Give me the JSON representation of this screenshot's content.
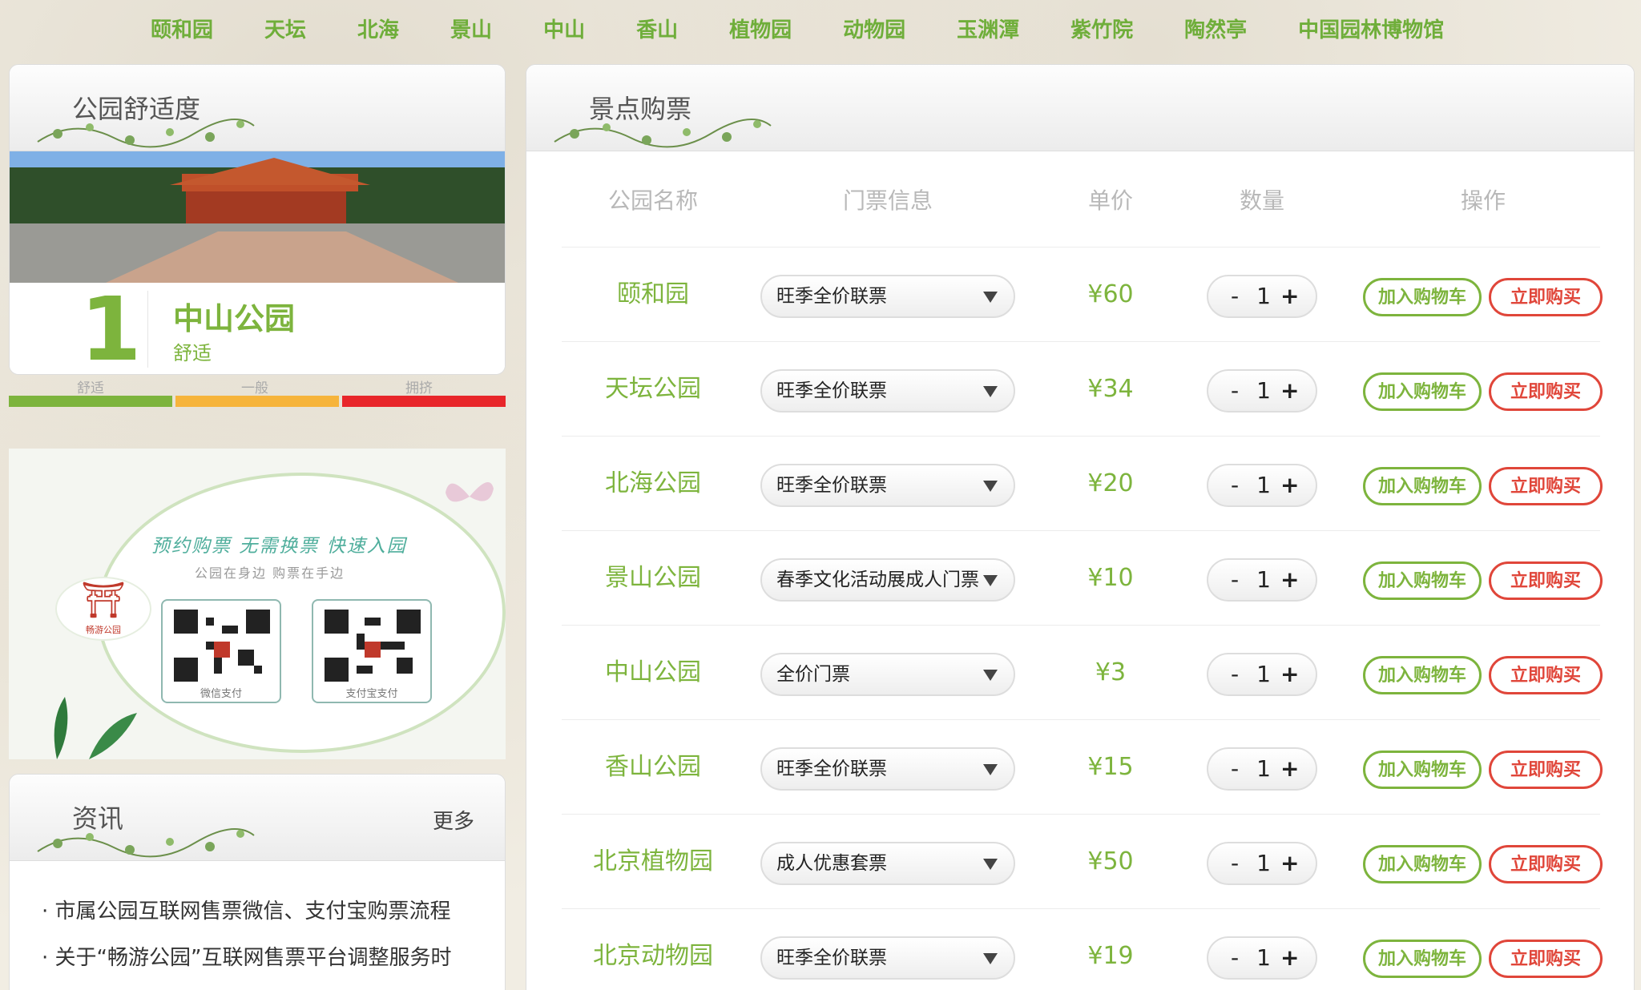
{
  "nav": [
    "颐和园",
    "天坛",
    "北海",
    "景山",
    "中山",
    "香山",
    "植物园",
    "动物园",
    "玉渊潭",
    "紫竹院",
    "陶然亭",
    "中国园林博物馆"
  ],
  "comfort": {
    "title": "公园舒适度",
    "level_number": "1",
    "park_name": "中山公园",
    "status": "舒适",
    "levels": [
      "舒适",
      "一般",
      "拥挤"
    ],
    "level_colors": [
      "#7db43d",
      "#f6b43b",
      "#e8262a"
    ]
  },
  "promo": {
    "slogan": "预约购票  无需换票  快速入园",
    "sub": "公园在身边  购票在手边",
    "logo_label": "畅游公园",
    "qr_wechat": "微信支付",
    "qr_alipay": "支付宝支付"
  },
  "news": {
    "title": "资讯",
    "more": "更多",
    "items": [
      "· 市属公园互联网售票微信、支付宝购票流程",
      "· 关于“畅游公园”互联网售票平台调整服务时"
    ]
  },
  "tickets": {
    "title": "景点购票",
    "columns": [
      "公园名称",
      "门票信息",
      "单价",
      "数量",
      "操作"
    ],
    "cart_label": "加入购物车",
    "buy_label": "立即购买",
    "minus": "-",
    "plus": "+",
    "rows": [
      {
        "park": "颐和园",
        "ticket": "旺季全价联票",
        "price": "¥60",
        "qty": "1"
      },
      {
        "park": "天坛公园",
        "ticket": "旺季全价联票",
        "price": "¥34",
        "qty": "1"
      },
      {
        "park": "北海公园",
        "ticket": "旺季全价联票",
        "price": "¥20",
        "qty": "1"
      },
      {
        "park": "景山公园",
        "ticket": "春季文化活动展成人门票",
        "price": "¥10",
        "qty": "1"
      },
      {
        "park": "中山公园",
        "ticket": "全价门票",
        "price": "¥3",
        "qty": "1"
      },
      {
        "park": "香山公园",
        "ticket": "旺季全价联票",
        "price": "¥15",
        "qty": "1"
      },
      {
        "park": "北京植物园",
        "ticket": "成人优惠套票",
        "price": "¥50",
        "qty": "1"
      },
      {
        "park": "北京动物园",
        "ticket": "旺季全价联票",
        "price": "¥19",
        "qty": "1"
      }
    ]
  }
}
